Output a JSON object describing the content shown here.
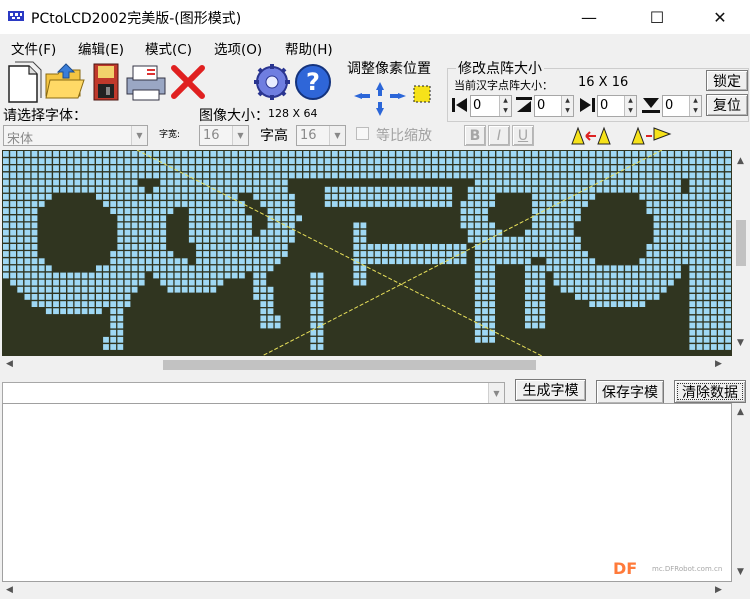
{
  "window": {
    "title": "PCtoLCD2002完美版-(图形模式)"
  },
  "controls": {
    "minimize": "—",
    "maximize": "☐",
    "close": "✕"
  },
  "menu": [
    "文件(F)",
    "编辑(E)",
    "模式(C)",
    "选项(O)",
    "帮助(H)"
  ],
  "toolbar": {
    "icons": [
      "new-file-icon",
      "open-folder-icon",
      "save-disk-icon",
      "print-icon",
      "delete-x-icon",
      "settings-gear-icon",
      "help-question-icon"
    ],
    "pixel_adjust_label": "调整像素位置",
    "matrix_size_label": "修改点阵大小",
    "current_size_label": "当前汉字点阵大小：",
    "current_size_value": "16  X  16",
    "lock_label": "锁定",
    "reset_label": "复位",
    "spinners": [
      "0",
      "0",
      "0",
      "0"
    ]
  },
  "font": {
    "select_label": "请选择字体：",
    "font_value": "宋体",
    "width_label": "字宽:",
    "width_value": "16",
    "image_size_label": "图像大小：",
    "image_size_value": "128  X  64",
    "height_label": "字高",
    "height_value": "16",
    "scale_label": "等比缩放",
    "bold": "B",
    "italic": "I",
    "underline": "U"
  },
  "lcd": {
    "cols": 102,
    "rows": 29,
    "on_color": "#9fd8f4",
    "off_color": "#303520",
    "cross_color": "#e8e05a"
  },
  "actions": {
    "generate": "生成字模",
    "save": "保存字模",
    "clear": "清除数据"
  },
  "watermark": {
    "brand": "DF",
    "site": "mc.DFRobot.com.cn"
  }
}
